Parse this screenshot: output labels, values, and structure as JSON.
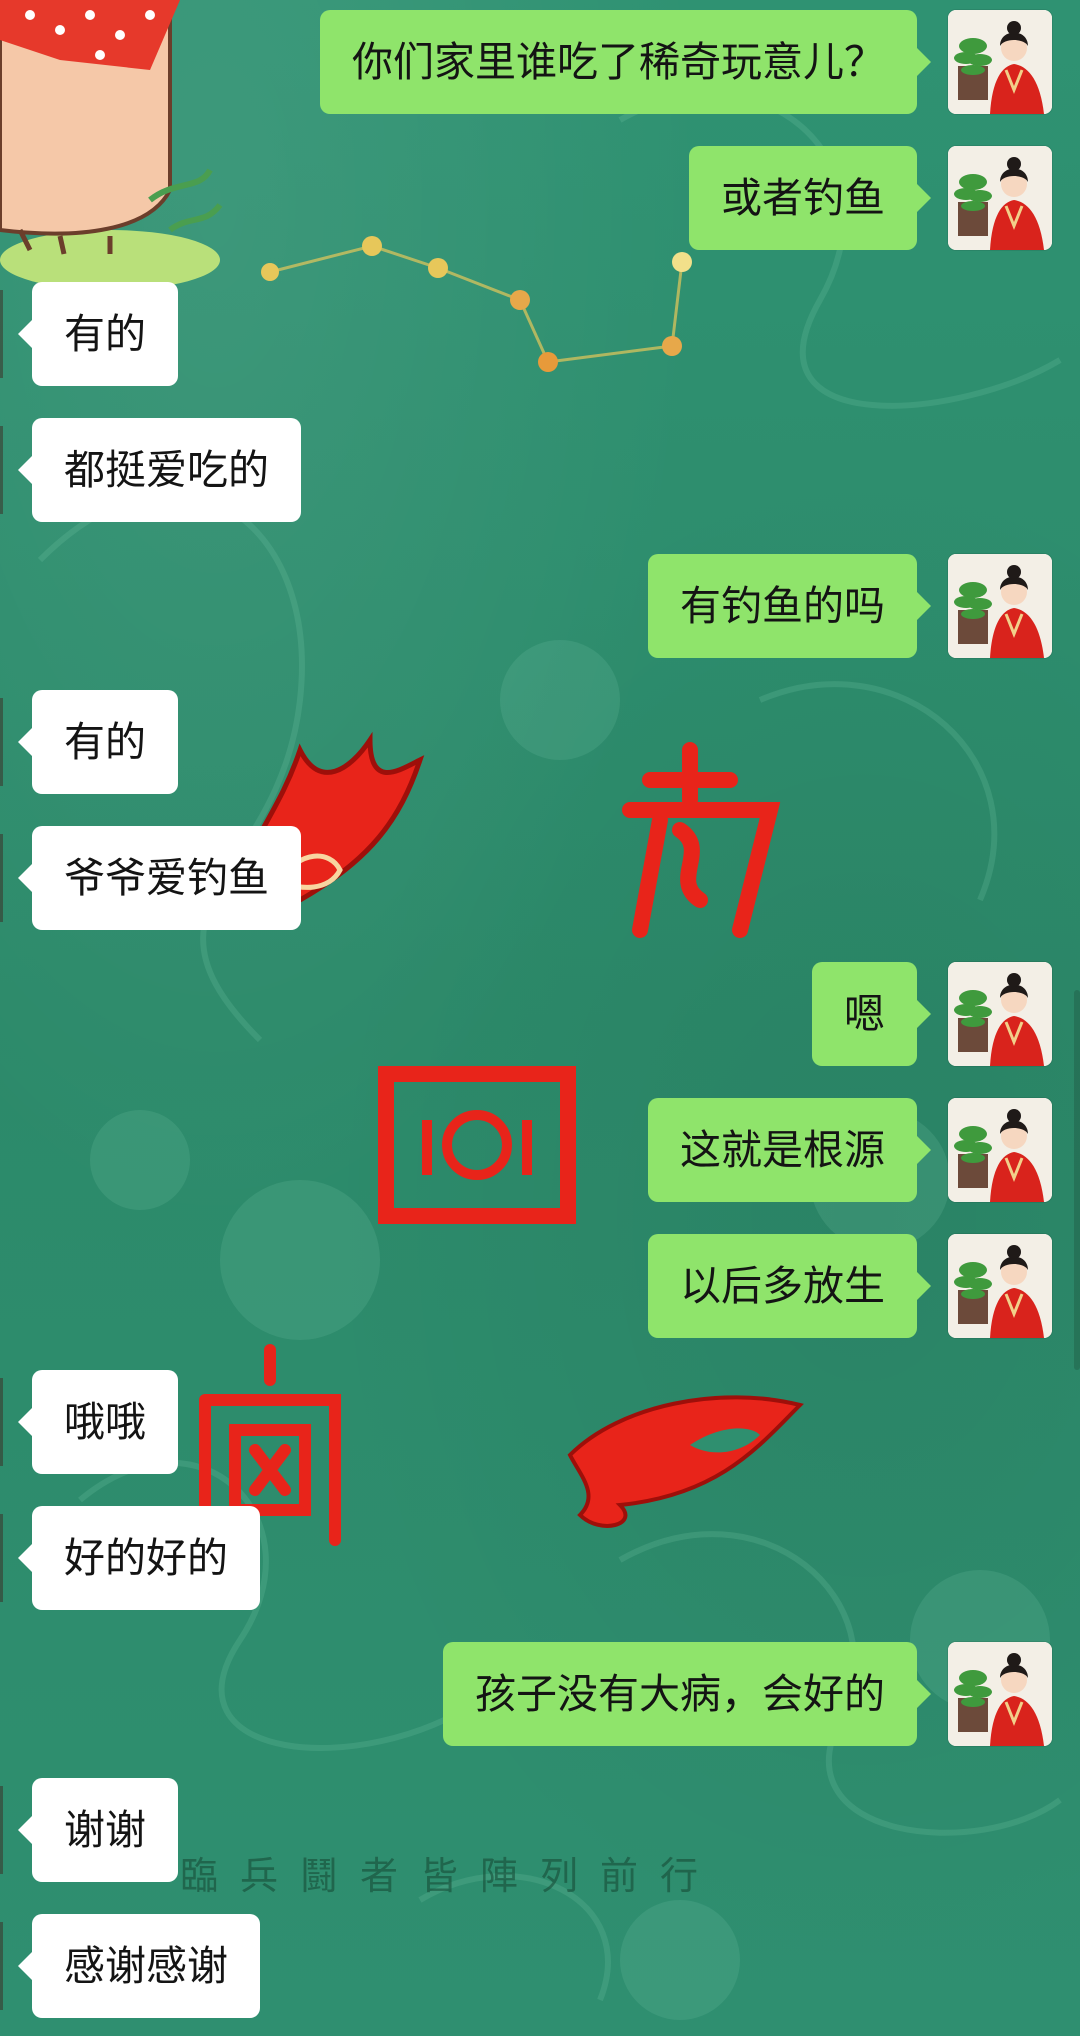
{
  "chat": {
    "messages": [
      {
        "side": "out",
        "text": "你们家里谁吃了稀奇玩意儿？"
      },
      {
        "side": "out",
        "text": "或者钓鱼"
      },
      {
        "side": "in",
        "text": "有的"
      },
      {
        "side": "in",
        "text": "都挺爱吃的"
      },
      {
        "side": "out",
        "text": "有钓鱼的吗"
      },
      {
        "side": "in",
        "text": "有的"
      },
      {
        "side": "in",
        "text": "爷爷爱钓鱼"
      },
      {
        "side": "out",
        "text": "嗯"
      },
      {
        "side": "out",
        "text": "这就是根源"
      },
      {
        "side": "out",
        "text": "以后多放生"
      },
      {
        "side": "in",
        "text": "哦哦"
      },
      {
        "side": "in",
        "text": "好的好的"
      },
      {
        "side": "out",
        "text": "孩子没有大病，会好的"
      },
      {
        "side": "in",
        "text": "谢谢"
      },
      {
        "side": "in",
        "text": "感谢感谢"
      }
    ]
  },
  "wallpaper": {
    "caption": "臨兵鬪者皆陣列前行",
    "accent_red": "#e8241a",
    "background_green": "#2f8f6f"
  },
  "colors": {
    "bubble_out": "#8fe46b",
    "bubble_in": "#ffffff"
  },
  "icons": {
    "sticker": "cartoon-pig-sticker",
    "avatar": "woman-in-red-hanfu-with-plant"
  }
}
